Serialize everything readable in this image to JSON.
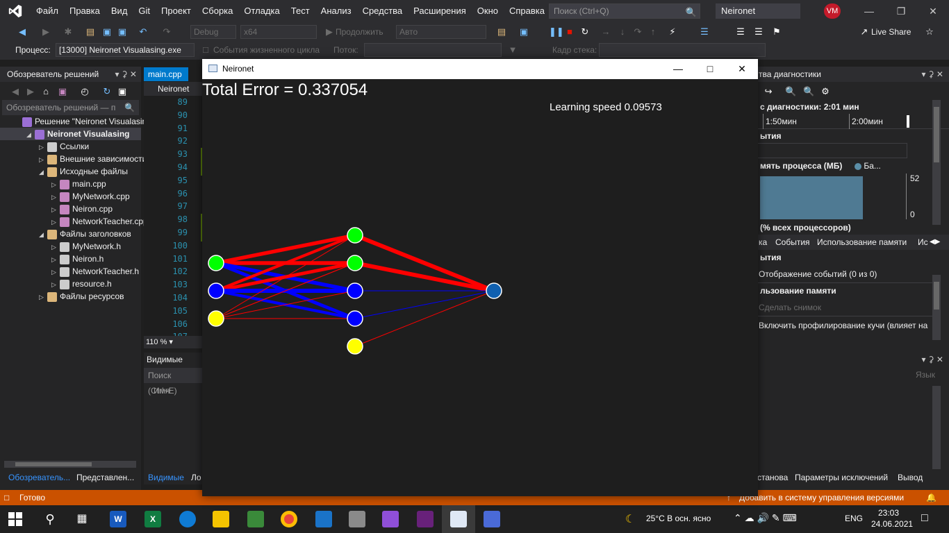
{
  "menubar": {
    "items": [
      "Файл",
      "Правка",
      "Вид",
      "Git",
      "Проект",
      "Сборка",
      "Отладка",
      "Тест",
      "Анализ",
      "Средства",
      "Расширения",
      "Окно",
      "Справка"
    ],
    "search_placeholder": "Поиск (Ctrl+Q)",
    "solution_name": "Neironet Visualasing",
    "avatar_initials": "VM"
  },
  "toolbar": {
    "config": "Debug",
    "platform": "x64",
    "continue_label": "Продолжить",
    "auto_label": "Авто",
    "live_share": "Live Share",
    "process_label": "Процесс:",
    "process_value": "[13000] Neironet Visualasing.exe",
    "lifecycle_label": "События жизненного цикла",
    "thread_label": "Поток:",
    "stack_label": "Кадр стека:"
  },
  "solution_explorer": {
    "title": "Обозреватель решений",
    "search_placeholder": "Обозреватель решений — п",
    "items": [
      {
        "label": "Решение \"Neironet Visualasin",
        "bold": false
      },
      {
        "label": "Neironet Visualasing",
        "bold": true
      },
      {
        "label": "Ссылки",
        "bold": false
      },
      {
        "label": "Внешние зависимости",
        "bold": false
      },
      {
        "label": "Исходные файлы",
        "bold": false
      },
      {
        "label": "main.cpp",
        "bold": false
      },
      {
        "label": "MyNetwork.cpp",
        "bold": false
      },
      {
        "label": "Neiron.cpp",
        "bold": false
      },
      {
        "label": "NetworkTeacher.cpp",
        "bold": false
      },
      {
        "label": "Файлы заголовков",
        "bold": false
      },
      {
        "label": "MyNetwork.h",
        "bold": false
      },
      {
        "label": "Neiron.h",
        "bold": false
      },
      {
        "label": "NetworkTeacher.h",
        "bold": false
      },
      {
        "label": "resource.h",
        "bold": false
      },
      {
        "label": "Файлы ресурсов",
        "bold": false
      }
    ],
    "bottom_tabs": [
      "Обозреватель...",
      "Представлен..."
    ]
  },
  "editor": {
    "tab_label": "main.cpp",
    "nav_label": "Neironet Vis",
    "line_numbers": [
      "89",
      "90",
      "91",
      "92",
      "93",
      "94",
      "95",
      "96",
      "97",
      "98",
      "99",
      "100",
      "101",
      "102",
      "103",
      "104",
      "105",
      "106",
      "107"
    ],
    "zoom": "110 %"
  },
  "watch": {
    "title": "Видимые",
    "search_placeholder": "Поиск (Ctrl+E)",
    "column_name": "Имя",
    "bottom_tabs": [
      "Видимые",
      "Ло"
    ]
  },
  "diagnostics": {
    "title": "тва диагностики",
    "session_label": "с диагностики: 2:01 мин",
    "time_ticks": [
      "1:50мин",
      "2:00мин"
    ],
    "events_label": "ытия",
    "memory_label": "мять процесса (МБ)",
    "legend_label": "Ба...",
    "mem_max": "52",
    "mem_min": "0",
    "cpu_label": "(% всех процессоров)",
    "tabs": [
      "ка",
      "События",
      "Использование памяти",
      "Ис"
    ],
    "events_header": "ытия",
    "events_show": "Отображение событий (0 из 0)",
    "memory_header": "льзование памяти",
    "snapshot": "Сделать снимок",
    "heap_profiling": "Включить профилирование кучи (влияет на",
    "lower_column": "Язык",
    "bottom_tabs": [
      "станова",
      "Параметры исключений",
      "Вывод"
    ]
  },
  "statusbar": {
    "ready": "Готово",
    "source_control": "Добавить в систему управления версиями"
  },
  "taskbar": {
    "weather": "25°C  В осн. ясно",
    "language": "ENG",
    "time": "23:03",
    "date": "24.06.2021"
  },
  "neironet": {
    "title": "Neironet",
    "total_error": "Total Error = 0.337054",
    "learning_speed": "Learning speed 0.09573",
    "colors": {
      "active": "#00ff00",
      "inactive": "#0000ff",
      "bias": "#ffff00",
      "output": "#1060b0",
      "positive": "#ff0000",
      "negative": "#0000ff"
    },
    "layers": [
      [
        {
          "state": "active"
        },
        {
          "state": "inactive"
        },
        {
          "state": "bias"
        }
      ],
      [
        {
          "state": "active"
        },
        {
          "state": "active"
        },
        {
          "state": "inactive"
        },
        {
          "state": "inactive"
        },
        {
          "state": "bias"
        }
      ],
      [
        {
          "state": "output"
        }
      ]
    ],
    "connections": [
      {
        "from": [
          0,
          0
        ],
        "to": [
          1,
          0
        ],
        "sign": "positive",
        "weight": 0.9
      },
      {
        "from": [
          0,
          0
        ],
        "to": [
          1,
          1
        ],
        "sign": "positive",
        "weight": 0.9
      },
      {
        "from": [
          0,
          0
        ],
        "to": [
          1,
          2
        ],
        "sign": "negative",
        "weight": 0.9
      },
      {
        "from": [
          0,
          0
        ],
        "to": [
          1,
          3
        ],
        "sign": "negative",
        "weight": 0.8
      },
      {
        "from": [
          0,
          1
        ],
        "to": [
          1,
          0
        ],
        "sign": "positive",
        "weight": 0.7
      },
      {
        "from": [
          0,
          1
        ],
        "to": [
          1,
          1
        ],
        "sign": "positive",
        "weight": 0.8
      },
      {
        "from": [
          0,
          1
        ],
        "to": [
          1,
          2
        ],
        "sign": "negative",
        "weight": 1.0
      },
      {
        "from": [
          0,
          1
        ],
        "to": [
          1,
          3
        ],
        "sign": "negative",
        "weight": 0.7
      },
      {
        "from": [
          0,
          2
        ],
        "to": [
          1,
          0
        ],
        "sign": "positive",
        "weight": 0.1
      },
      {
        "from": [
          0,
          2
        ],
        "to": [
          1,
          1
        ],
        "sign": "positive",
        "weight": 0.2
      },
      {
        "from": [
          0,
          2
        ],
        "to": [
          1,
          2
        ],
        "sign": "positive",
        "weight": 0.15
      },
      {
        "from": [
          0,
          2
        ],
        "to": [
          1,
          3
        ],
        "sign": "positive",
        "weight": 0.1
      },
      {
        "from": [
          1,
          0
        ],
        "to": [
          2,
          0
        ],
        "sign": "positive",
        "weight": 1.0
      },
      {
        "from": [
          1,
          1
        ],
        "to": [
          2,
          0
        ],
        "sign": "positive",
        "weight": 1.0
      },
      {
        "from": [
          1,
          2
        ],
        "to": [
          2,
          0
        ],
        "sign": "negative",
        "weight": 0.1
      },
      {
        "from": [
          1,
          3
        ],
        "to": [
          2,
          0
        ],
        "sign": "negative",
        "weight": 0.15
      },
      {
        "from": [
          1,
          4
        ],
        "to": [
          2,
          0
        ],
        "sign": "positive",
        "weight": 0.12
      }
    ]
  }
}
